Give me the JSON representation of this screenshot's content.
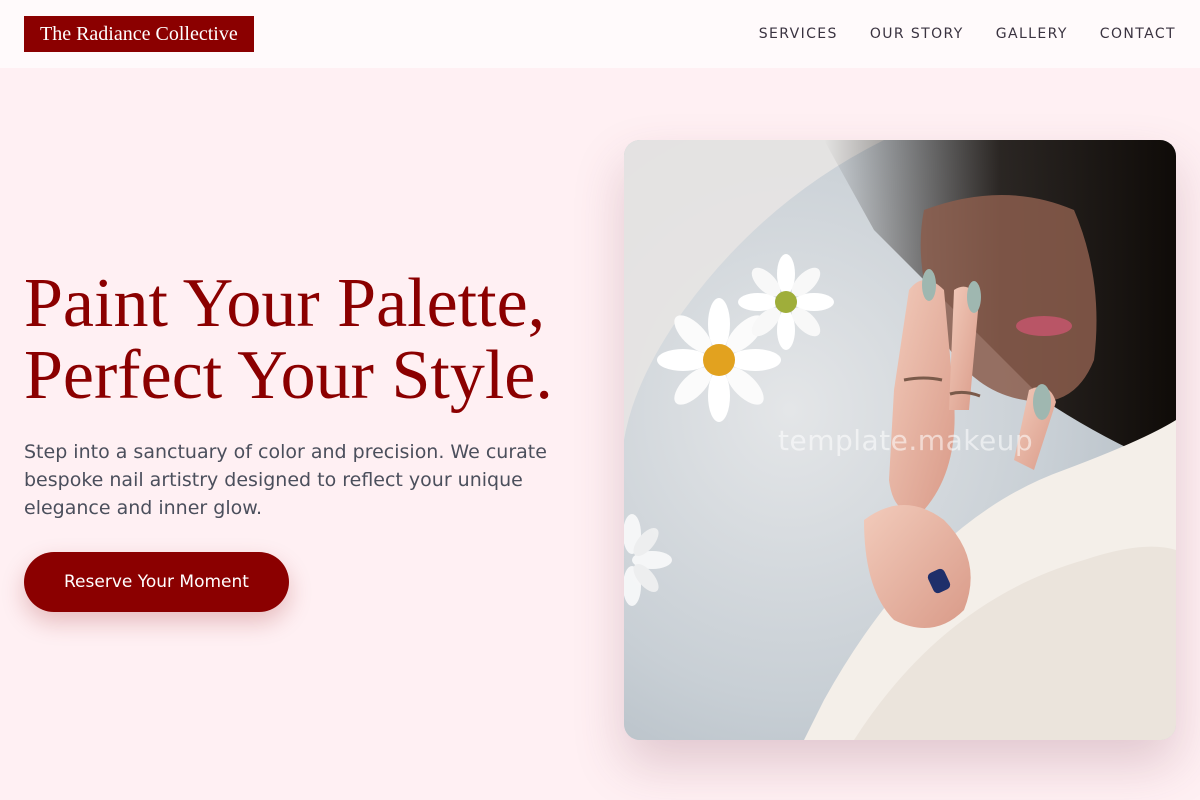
{
  "header": {
    "brand": "The Radiance Collective",
    "nav": [
      "SERVICES",
      "OUR STORY",
      "GALLERY",
      "CONTACT"
    ]
  },
  "hero": {
    "title_line1": "Paint Your Palette,",
    "title_line2": "Perfect Your Style.",
    "subtitle": "Step into a sanctuary of color and precision. We curate bespoke nail artistry designed to reflect your unique elegance and inner glow.",
    "cta_label": "Reserve Your Moment",
    "image_watermark": "template.makeup"
  },
  "colors": {
    "brand": "#8b0000",
    "page_background": "#fff0f3",
    "body_text": "#4b4f5c"
  }
}
